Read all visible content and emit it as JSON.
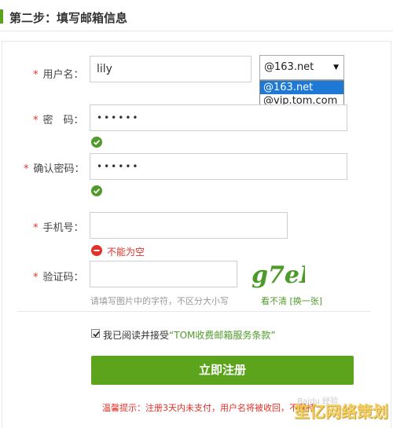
{
  "header": {
    "title": "第二步：填写邮箱信息"
  },
  "form": {
    "required_mark": "*",
    "username": {
      "label": "用户名：",
      "value": "lily"
    },
    "domain_select": {
      "selected": "@163.net",
      "options": [
        "@163.net",
        "@vip.tom.com"
      ],
      "arrow": "▼"
    },
    "password": {
      "label": "密　码：",
      "value": "••••••"
    },
    "confirm_password": {
      "label": "确认密码：",
      "value": "••••••"
    },
    "phone": {
      "label": "手机号：",
      "value": "",
      "error": "不能为空"
    },
    "captcha": {
      "label": "验证码：",
      "value": "",
      "hint": "请填写图片中的字符，不区分大小写",
      "image_text": "g7eP",
      "refresh_link": "看不清 [换一张]"
    },
    "agreement": {
      "checked": true,
      "text": "我已阅读并接受",
      "link": "“TOM收费邮箱服务条款”"
    },
    "submit_label": "立即注册",
    "notice": "温馨提示：注册3天内未支付，用户名将被收回，不保持"
  },
  "watermark": {
    "text": "笙亿网络策划",
    "faint": "Baidu 经验"
  },
  "colors": {
    "accent": "#5ba41c",
    "error": "#e0322a",
    "select_highlight": "#1e79d6"
  }
}
